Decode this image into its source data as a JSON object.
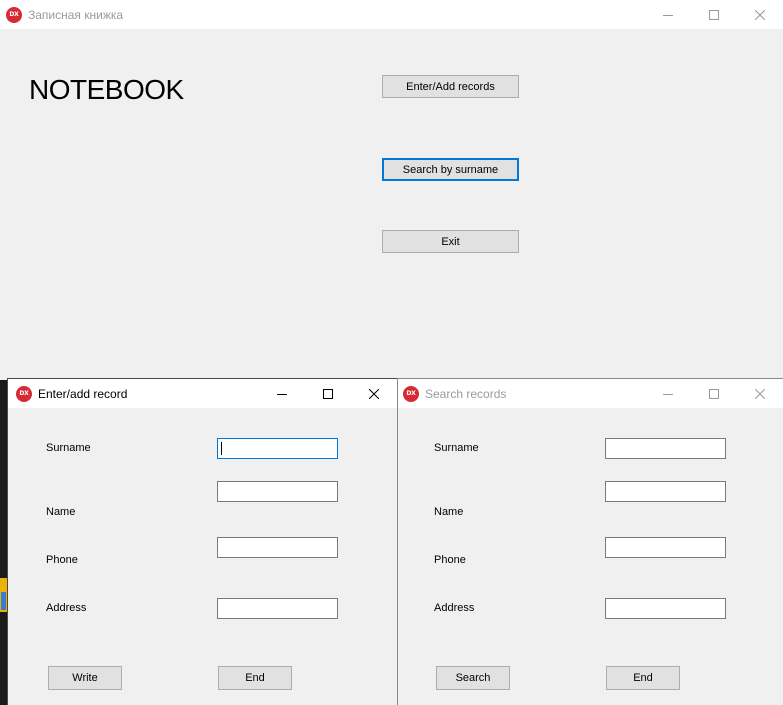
{
  "main_window": {
    "title": "Записная книжка",
    "heading": "NOTEBOOK",
    "buttons": {
      "enter_add": "Enter/Add records",
      "search": "Search by surname",
      "exit": "Exit"
    }
  },
  "enter_window": {
    "title": "Enter/add record",
    "labels": {
      "surname": "Surname",
      "name": "Name",
      "phone": "Phone",
      "address": "Address"
    },
    "fields": {
      "surname": "",
      "name": "",
      "phone": "",
      "address": ""
    },
    "buttons": {
      "write": "Write",
      "end": "End"
    }
  },
  "search_window": {
    "title": "Search records",
    "labels": {
      "surname": "Surname",
      "name": "Name",
      "phone": "Phone",
      "address": "Address"
    },
    "fields": {
      "surname": "",
      "name": "",
      "phone": "",
      "address": ""
    },
    "buttons": {
      "search": "Search",
      "end": "End"
    }
  },
  "app_icon_text": "DX",
  "icons": [
    "app-icon",
    "minimize-icon",
    "maximize-icon",
    "close-icon"
  ],
  "colors": {
    "focus": "#0078d7",
    "app_icon": "#d62b35",
    "window_bg": "#f0f0f0"
  }
}
